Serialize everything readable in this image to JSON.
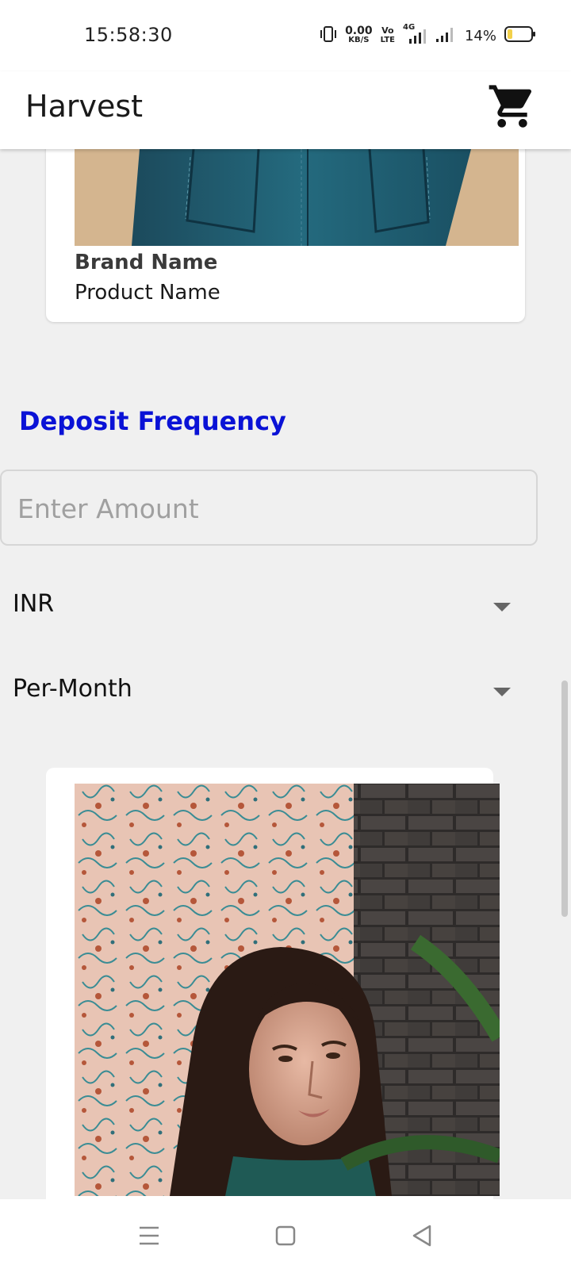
{
  "status_bar": {
    "time": "15:58:30",
    "net_speed_value": "0.00",
    "net_speed_unit": "KB/S",
    "volte_top": "Vo",
    "volte_bottom": "LTE",
    "network_type": "4G",
    "battery_percent": "14%",
    "battery_level": 0.14
  },
  "app_bar": {
    "title": "Harvest",
    "cart_icon": "shopping-cart-icon"
  },
  "product_card": {
    "brand": "Brand Name",
    "product": "Product Name",
    "image": "denim-jeans-photo"
  },
  "deposit": {
    "section_title": "Deposit Frequency",
    "amount_placeholder": "Enter Amount",
    "amount_value": "",
    "currency": "INR",
    "frequency": "Per-Month"
  },
  "second_card": {
    "image": "woman-portrait-photo"
  },
  "nav_bar": {
    "menu_icon": "menu-icon",
    "home_icon": "home-square-icon",
    "back_icon": "back-triangle-icon"
  },
  "colors": {
    "accent": "#0a12d6",
    "background": "#f0f0f0",
    "surface": "#ffffff",
    "battery_low": "#f2d04a"
  }
}
